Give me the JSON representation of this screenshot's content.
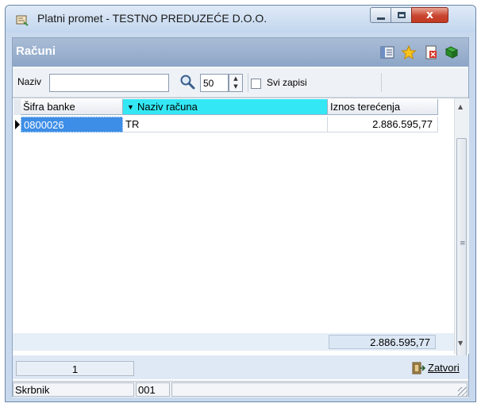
{
  "window": {
    "title": "Platni promet - TESTNO PREDUZEĆE D.O.O.",
    "close_glyph": "x"
  },
  "section": {
    "title": "Računi",
    "icons": [
      "columns-icon",
      "star-icon",
      "delete-icon",
      "export-icon"
    ]
  },
  "filter": {
    "naziv_label": "Naziv",
    "naziv_value": "",
    "limit_value": "50",
    "svi_zapisi_label": "Svi zapisi",
    "svi_zapisi_checked": false
  },
  "grid": {
    "columns": [
      "Šifra banke",
      "Naziv računa",
      "Iznos terećenja"
    ],
    "sort_column": "Naziv računa",
    "rows": [
      {
        "sifra": "0800026",
        "naziv": "TR",
        "iznos": "2.886.595,77"
      }
    ],
    "total": "2.886.595,77"
  },
  "footer": {
    "record_count": "1",
    "close_label": "Zatvori"
  },
  "status_bar": {
    "user": "Skrbnik",
    "code": "001",
    "extra": ""
  },
  "colors": {
    "accent_header": "#8da6c7",
    "sort_column_bg": "#33e8f4",
    "selection": "#3d8ee6"
  }
}
